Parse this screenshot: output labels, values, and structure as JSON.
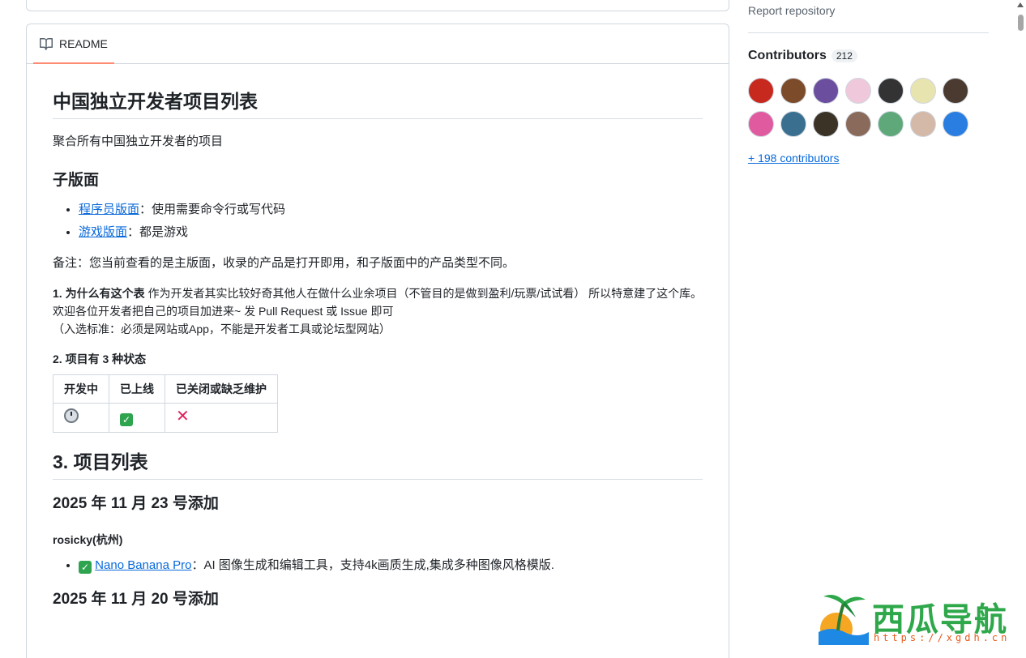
{
  "sidebar": {
    "report_label": "Report repository",
    "contributors_label": "Contributors",
    "contributors_count": "212",
    "more_contributors": "+ 198 contributors"
  },
  "readme": {
    "tab_label": "README",
    "title": "中国独立开发者项目列表",
    "subtitle": "聚合所有中国独立开发者的项目",
    "sub_heading": "子版面",
    "sub_items": [
      {
        "link": "程序员版面",
        "desc": "：使用需要命令行或写代码"
      },
      {
        "link": "游戏版面",
        "desc": "：都是游戏"
      }
    ],
    "note": "备注：您当前查看的是主版面，收录的产品是打开即用，和子版面中的产品类型不同。",
    "why_bold": "1. 为什么有这个表",
    "why_text": " 作为开发者其实比较好奇其他人在做什么业余项目（不管目的是做到盈利/玩票/试试看） 所以特意建了这个库。欢迎各位开发者把自己的项目加进来~ 发 Pull Request 或 Issue 即可",
    "criteria": "（入选标准：必须是网站或App，不能是开发者工具或论坛型网站）",
    "states_heading": "2. 项目有 3 种状态",
    "states_headers": [
      "开发中",
      "已上线",
      "已关闭或缺乏维护"
    ],
    "list_heading": "3. 项目列表",
    "date1": "2025 年 11 月 23 号添加",
    "author1": "rosicky(杭州)",
    "project1_link": "Nano Banana Pro",
    "project1_desc": "：AI 图像生成和编辑工具，支持4k画质生成,集成多种图像风格模版.",
    "date2": "2025 年 11 月 20 号添加"
  },
  "watermark": {
    "title": "西瓜导航",
    "url": "https://xgdh.cn"
  },
  "colors": {
    "link": "#0969da",
    "tab_underline": "#fd8c73",
    "check": "#2ea44f",
    "cross": "#e0245e"
  }
}
